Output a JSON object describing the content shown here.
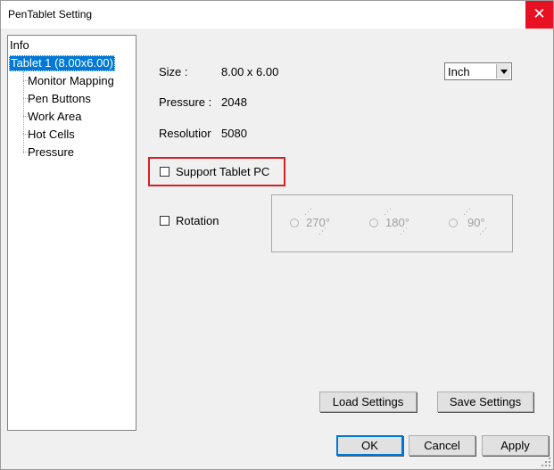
{
  "window": {
    "title": "PenTablet Setting",
    "close_glyph": "✕"
  },
  "tree": {
    "items": [
      {
        "label": "Info"
      },
      {
        "label": "Tablet  1 (8.00x6.00)"
      },
      {
        "label": "Monitor Mapping"
      },
      {
        "label": "Pen Buttons"
      },
      {
        "label": "Work Area"
      },
      {
        "label": "Hot Cells"
      },
      {
        "label": "Pressure"
      }
    ]
  },
  "info": {
    "size_label": "Size :",
    "size_value": "8.00 x 6.00",
    "pressure_label": "Pressure :",
    "pressure_value": "2048",
    "resolution_label": "Resolutior",
    "resolution_value": "5080",
    "unit_selected": "Inch"
  },
  "options": {
    "support_tablet_pc_label": "Support Tablet PC",
    "support_tablet_pc_checked": false,
    "rotation_label": "Rotation",
    "rotation_checked": false,
    "rotation_options": [
      "270°",
      "180°",
      "90°"
    ]
  },
  "buttons": {
    "load": "Load Settings",
    "save": "Save Settings",
    "ok": "OK",
    "cancel": "Cancel",
    "apply": "Apply"
  },
  "colors": {
    "highlight_border": "#d71f26",
    "selection": "#0078d7",
    "close_button": "#e81123"
  }
}
